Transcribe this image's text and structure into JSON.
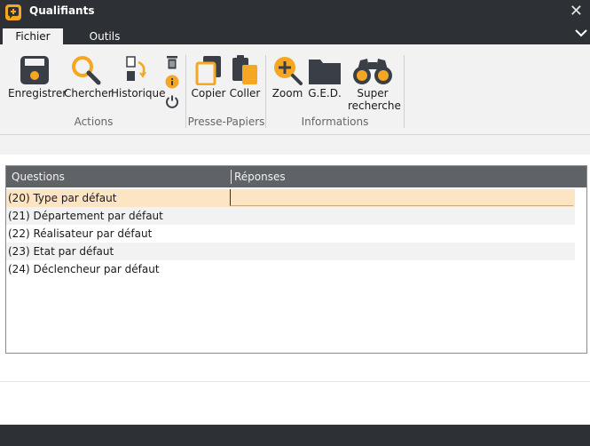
{
  "window": {
    "title": "Qualifiants",
    "close_glyph": "✕"
  },
  "tabs": [
    {
      "label": "Fichier",
      "active": true
    },
    {
      "label": "Outils",
      "active": false
    }
  ],
  "ribbon": {
    "actions": {
      "group_label": "Actions",
      "save_label": "Enregistrer",
      "search_label": "Chercher",
      "history_label": "Historique"
    },
    "clipboard": {
      "group_label": "Presse-Papiers",
      "copy_label": "Copier",
      "paste_label": "Coller"
    },
    "info": {
      "group_label": "Informations",
      "zoom_label": "Zoom",
      "ged_label": "G.E.D.",
      "super_label_1": "Super",
      "super_label_2": "recherche"
    }
  },
  "grid": {
    "col_questions": "Questions",
    "col_answers": "Réponses",
    "rows": [
      {
        "question": "(20) Type par défaut",
        "answer": ""
      },
      {
        "question": "(21) Département par défaut",
        "answer": ""
      },
      {
        "question": "(22) Réalisateur par défaut",
        "answer": ""
      },
      {
        "question": "(23) Etat par défaut",
        "answer": ""
      },
      {
        "question": "(24) Déclencheur par défaut",
        "answer": ""
      }
    ]
  },
  "colors": {
    "accent": "#f5a623",
    "titlebar": "#2d3034",
    "ribbon": "#f2f2f2",
    "icon_dark": "#3a3f47",
    "selected_row": "#fde4c3"
  },
  "icons": {
    "app": "app-logo-icon",
    "save": "floppy-icon",
    "search": "magnifier-icon",
    "history": "history-icon",
    "delete": "trash-icon",
    "info": "info-icon",
    "power": "power-icon",
    "copy": "copy-icon",
    "paste": "paste-icon",
    "zoom": "zoom-in-icon",
    "ged": "folder-icon",
    "super_search": "binoculars-icon",
    "collapse": "chevron-down-icon"
  }
}
